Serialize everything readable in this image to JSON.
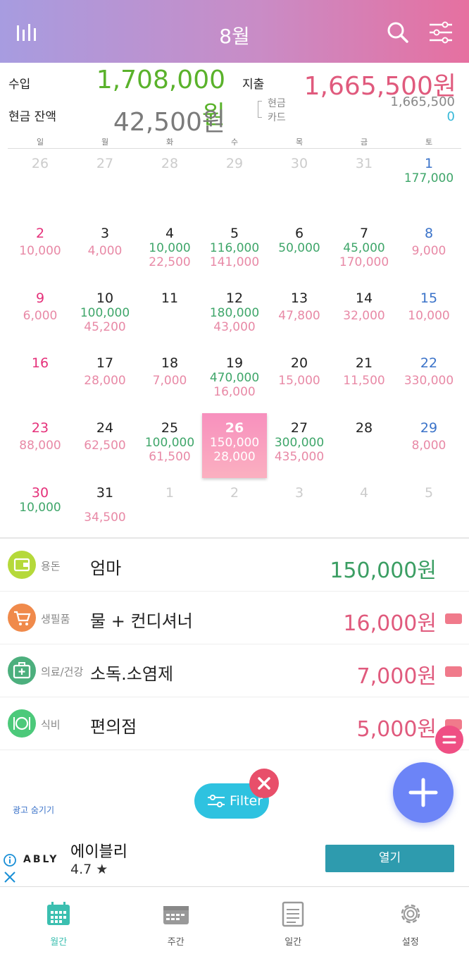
{
  "header": {
    "title": "8월"
  },
  "summary": {
    "income_label": "수입",
    "income_value": "1,708,000원",
    "expense_label": "지출",
    "expense_value": "1,665,500원",
    "balance_label": "현금 잔액",
    "balance_value": "42,500원",
    "cash_label": "현금",
    "cash_value": "1,665,500",
    "card_label": "카드",
    "card_value": "0"
  },
  "calendar": {
    "weekdays": [
      "일",
      "월",
      "화",
      "수",
      "목",
      "금",
      "토"
    ],
    "weeks": [
      [
        {
          "d": "26",
          "o": true
        },
        {
          "d": "27",
          "o": true
        },
        {
          "d": "28",
          "o": true
        },
        {
          "d": "29",
          "o": true
        },
        {
          "d": "30",
          "o": true
        },
        {
          "d": "31",
          "o": true
        },
        {
          "d": "1",
          "i": "177,000"
        }
      ],
      [
        {
          "d": "2",
          "e": "10,000"
        },
        {
          "d": "3",
          "e": "4,000"
        },
        {
          "d": "4",
          "i": "10,000",
          "e": "22,500"
        },
        {
          "d": "5",
          "i": "116,000",
          "e": "141,000"
        },
        {
          "d": "6",
          "i": "50,000"
        },
        {
          "d": "7",
          "i": "45,000",
          "e": "170,000"
        },
        {
          "d": "8",
          "e": "9,000"
        }
      ],
      [
        {
          "d": "9",
          "e": "6,000"
        },
        {
          "d": "10",
          "i": "100,000",
          "e": "45,200"
        },
        {
          "d": "11"
        },
        {
          "d": "12",
          "i": "180,000",
          "e": "43,000"
        },
        {
          "d": "13",
          "e": "47,800"
        },
        {
          "d": "14",
          "e": "32,000"
        },
        {
          "d": "15",
          "e": "10,000"
        }
      ],
      [
        {
          "d": "16"
        },
        {
          "d": "17",
          "e": "28,000"
        },
        {
          "d": "18",
          "e": "7,000"
        },
        {
          "d": "19",
          "i": "470,000",
          "e": "16,000"
        },
        {
          "d": "20",
          "e": "15,000"
        },
        {
          "d": "21",
          "e": "11,500"
        },
        {
          "d": "22",
          "e": "330,000"
        }
      ],
      [
        {
          "d": "23",
          "e": "88,000"
        },
        {
          "d": "24",
          "e": "62,500"
        },
        {
          "d": "25",
          "i": "100,000",
          "e": "61,500"
        },
        {
          "d": "26",
          "i": "150,000",
          "e": "28,000",
          "today": true
        },
        {
          "d": "27",
          "i": "300,000",
          "e": "435,000"
        },
        {
          "d": "28"
        },
        {
          "d": "29",
          "e": "8,000"
        }
      ],
      [
        {
          "d": "30",
          "i": "10,000"
        },
        {
          "d": "31",
          "e": "34,500"
        },
        {
          "d": "1",
          "o": true
        },
        {
          "d": "2",
          "o": true
        },
        {
          "d": "3",
          "o": true
        },
        {
          "d": "4",
          "o": true
        },
        {
          "d": "5",
          "o": true
        }
      ]
    ]
  },
  "transactions": [
    {
      "category": "용돈",
      "icon": "wallet-icon",
      "color": "#b5d93a",
      "desc": "엄마",
      "amount": "150,000원",
      "type": "income",
      "card": false
    },
    {
      "category": "생필품",
      "icon": "cart-icon",
      "color": "#f08a4b",
      "desc": "물 + 컨디셔너",
      "amount": "16,000원",
      "type": "expense",
      "card": true
    },
    {
      "category": "의료/건강",
      "icon": "medical-kit-icon",
      "color": "#4caf7d",
      "desc": "소독.소염제",
      "amount": "7,000원",
      "type": "expense",
      "card": true
    },
    {
      "category": "식비",
      "icon": "dining-icon",
      "color": "#4cc97a",
      "desc": "편의점",
      "amount": "5,000원",
      "type": "expense",
      "card": true
    }
  ],
  "filter": {
    "label": "Filter"
  },
  "ad_hide": "광고 숨기기",
  "ad": {
    "brand": "ABLY",
    "app_name": "에이블리",
    "rating": "4.7 ★",
    "open_label": "열기"
  },
  "nav": [
    {
      "label": "월간",
      "icon": "monthly-calendar-icon",
      "active": true
    },
    {
      "label": "주간",
      "icon": "weekly-calendar-icon",
      "active": false
    },
    {
      "label": "일간",
      "icon": "daily-notepad-icon",
      "active": false
    },
    {
      "label": "설정",
      "icon": "settings-gear-icon",
      "active": false
    }
  ],
  "colors": {
    "accent_income": "#5ab22b",
    "accent_expense": "#e05a7d",
    "nav_active": "#3bbfb0",
    "fab": "#6c84f7"
  }
}
